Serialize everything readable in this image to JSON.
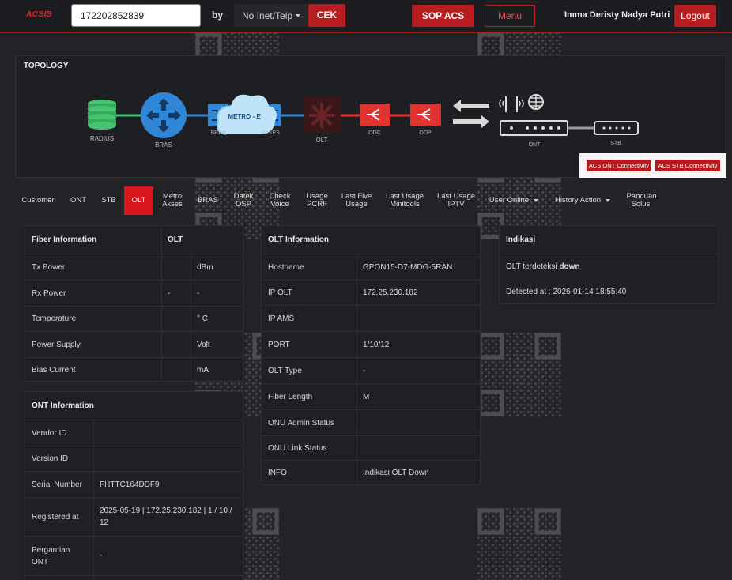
{
  "header": {
    "logo": "ACSIS",
    "search_value": "172202852839",
    "by_label": "by",
    "select_value": "No Inet/Telp",
    "cek_label": "CEK",
    "sop_label": "SOP ACS",
    "menu_label": "Menu",
    "username": "Imma Deristy Nadya Putri",
    "logout_label": "Logout"
  },
  "topology": {
    "title": "TOPOLOGY",
    "nodes": {
      "radius": "RADIUS",
      "bras": "BRAS",
      "bras2": "BRAS",
      "metro": "METRO - E",
      "akses": "AKSES",
      "olt": "OLT",
      "odc": "ODC",
      "odp": "ODP",
      "ont": "ONT",
      "stb": "STB"
    },
    "acs_ont_label": "ACS ONT Connectivity",
    "acs_stb_label": "ACS STB Connectivity"
  },
  "tabs": [
    {
      "line1": "Customer",
      "line2": ""
    },
    {
      "line1": "ONT",
      "line2": ""
    },
    {
      "line1": "STB",
      "line2": ""
    },
    {
      "line1": "OLT",
      "line2": ""
    },
    {
      "line1": "Metro",
      "line2": "Akses"
    },
    {
      "line1": "BRAS",
      "line2": ""
    },
    {
      "line1": "Datek",
      "line2": "OSP"
    },
    {
      "line1": "Check",
      "line2": "Voice"
    },
    {
      "line1": "Usage",
      "line2": "PCRF"
    },
    {
      "line1": "Last Five",
      "line2": "Usage"
    },
    {
      "line1": "Last Usage",
      "line2": "Minitools"
    },
    {
      "line1": "Last Usage",
      "line2": "IPTV"
    },
    {
      "line1": "User Online",
      "line2": ""
    },
    {
      "line1": "History Action",
      "line2": ""
    },
    {
      "line1": "Panduan",
      "line2": "Solusi"
    }
  ],
  "fiber": {
    "title": "Fiber Information",
    "col_olt": "OLT",
    "rows": [
      {
        "label": "Tx Power",
        "olt": "",
        "unit": "dBm"
      },
      {
        "label": "Rx Power",
        "olt": "-",
        "unit": "-"
      },
      {
        "label": "Temperature",
        "olt": "",
        "unit": "° C"
      },
      {
        "label": "Power Supply",
        "olt": "",
        "unit": "Volt"
      },
      {
        "label": "Bias Current",
        "olt": "",
        "unit": "mA"
      }
    ]
  },
  "ont": {
    "title": "ONT Information",
    "rows": [
      {
        "label": "Vendor ID",
        "value": ""
      },
      {
        "label": "Version ID",
        "value": ""
      },
      {
        "label": "Serial Number",
        "value": "FHTTC164DDF9"
      },
      {
        "label": "Registered at",
        "value": "2025-05-19 | 172.25.230.182 | 1 / 10 / 12"
      },
      {
        "label": "Pergantian ONT",
        "value": "-"
      }
    ]
  },
  "olt_info": {
    "title": "OLT Information",
    "rows": [
      {
        "label": "Hostname",
        "value": "GPON15-D7-MDG-5RAN"
      },
      {
        "label": "IP OLT",
        "value": "172.25.230.182"
      },
      {
        "label": "IP AMS",
        "value": ""
      },
      {
        "label": "PORT",
        "value": "1/10/12"
      },
      {
        "label": "OLT Type",
        "value": "-"
      },
      {
        "label": "Fiber Length",
        "value": "M"
      },
      {
        "label": "ONU Admin Status",
        "value": ""
      },
      {
        "label": "ONU Link Status",
        "value": ""
      },
      {
        "label": "INFO",
        "value": "Indikasi OLT Down"
      }
    ]
  },
  "indikasi": {
    "title": "Indikasi",
    "status_prefix": "OLT terdeteksi",
    "status_word": "down",
    "detected": "Detected at : 2026-01-14 18:55:40"
  },
  "colors": {
    "accent_red": "#b81c1f",
    "tab_active": "#d9161c",
    "link_green": "#3ec46d",
    "link_blue": "#2f86d6",
    "link_red": "#e0322f"
  }
}
